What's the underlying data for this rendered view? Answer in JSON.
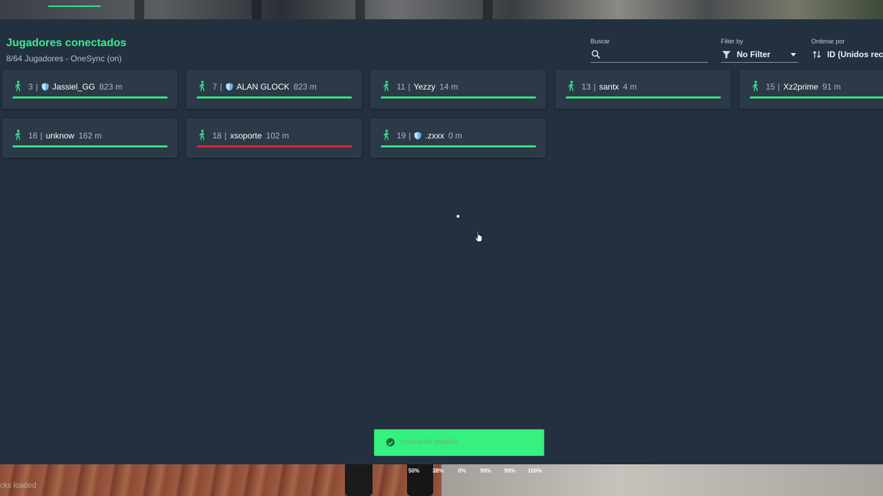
{
  "header": {
    "title": "Jugadores conectados",
    "subtitle": "8/64 Jugadores - OneSync (on)"
  },
  "controls": {
    "search_label": "Buscar",
    "search_placeholder": "",
    "filter_label": "Filter by",
    "filter_value": "No Filter",
    "sort_label": "Ordenar por",
    "sort_value": "ID (Unidos reci"
  },
  "players": [
    {
      "id": "3",
      "name": "Jassiel_GG",
      "distance": "823 m",
      "admin": true,
      "health": 1.0,
      "health_color": "#34e58a"
    },
    {
      "id": "7",
      "name": "ALAN GLOCK",
      "distance": "823 m",
      "admin": true,
      "health": 1.0,
      "health_color": "#34e58a"
    },
    {
      "id": "11",
      "name": "Yezzy",
      "distance": "14 m",
      "admin": false,
      "health": 1.0,
      "health_color": "#34e58a"
    },
    {
      "id": "13",
      "name": "santx",
      "distance": "4 m",
      "admin": false,
      "health": 1.0,
      "health_color": "#34e58a"
    },
    {
      "id": "15",
      "name": "Xz2prime",
      "distance": "91 m",
      "admin": false,
      "health": 1.0,
      "health_color": "#34e58a"
    },
    {
      "id": "16",
      "name": "unknow",
      "distance": "162 m",
      "admin": false,
      "health": 1.0,
      "health_color": "#34e58a"
    },
    {
      "id": "18",
      "name": "xsoporte",
      "distance": "102 m",
      "admin": false,
      "health": 1.0,
      "health_color": "#d8263a"
    },
    {
      "id": "19",
      "name": ".zxxx",
      "distance": "0 m",
      "admin": true,
      "health": 1.0,
      "health_color": "#34e58a"
    }
  ],
  "toast": {
    "message": "Invocando jugador",
    "color": "#36f07f"
  },
  "hud": {
    "stats": [
      "50%",
      "38%",
      "0%",
      "99%",
      "99%",
      "100%"
    ],
    "loading_text": "cks loaded"
  },
  "theme": {
    "accent": "#35ee8e",
    "panel_bg": "#23303f",
    "card_bg": "#2c3947"
  }
}
